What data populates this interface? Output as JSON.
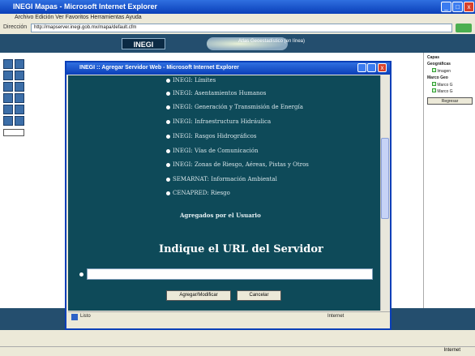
{
  "outer_window": {
    "title": "INEGI Mapas - Microsoft Internet Explorer",
    "menu": "Archivo   Edición   Ver   Favoritos   Herramientas   Ayuda",
    "address_label": "Dirección",
    "address_value": "http://mapserver.inegi.gob.mx/mapa/default.cfm"
  },
  "banner": {
    "logo": "INEGI",
    "subtitle": "Atlas Geoestadístico (en línea)"
  },
  "right_panel": {
    "title": "Capas",
    "section1": "Geográficas",
    "item1": "Imagen",
    "section2": "Marco Geo",
    "item2": "Marco G",
    "item3": "Marco G",
    "button": "Regresar"
  },
  "dialog": {
    "title": "INEGI :: Agregar Servidor Web - Microsoft Internet Explorer",
    "layers": [
      "INEGI: Límites",
      "INEGI: Asentamientos Humanos",
      "INEGI: Generación y Transmisión de Energía",
      "INEGI: Infraestructura Hidráulica",
      "INEGI: Rasgos Hidrográficos",
      "INEGI: Vías de Comunicación",
      "INEGI: Zonas de Riesgo, Aéreas, Pistas y Otros",
      "SEMARNAT: Información Ambiental",
      "CENAPRED: Riesgo"
    ],
    "user_added": "Agregados por el Usuario",
    "url_heading": "Indique el URL del Servidor",
    "url_value": "",
    "add_button": "Agregar/Modificar",
    "cancel_button": "Cancelar",
    "status_left": "Listo",
    "status_right": "Internet"
  },
  "outer_status": {
    "right": "Internet"
  }
}
